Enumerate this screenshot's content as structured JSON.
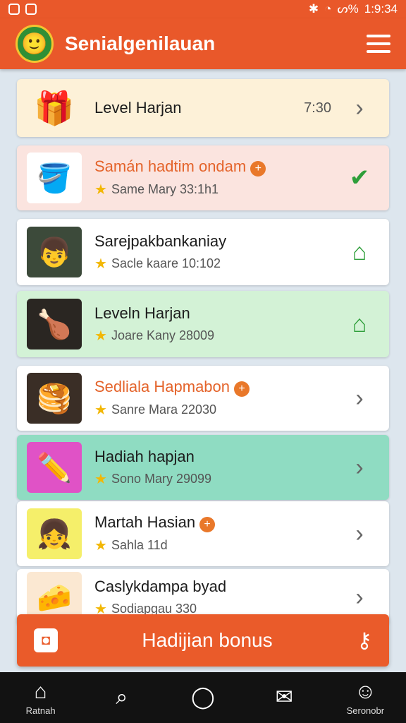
{
  "status": {
    "time": "1:9:34",
    "battery": "ᔕ%"
  },
  "header": {
    "title": "Senialgenilauan"
  },
  "rows": [
    {
      "title": "Level Harjan",
      "time": "7:30",
      "action": "chevron-right"
    },
    {
      "title": "Samán hadtim ondam",
      "sub": "Same Mary 33:1h1",
      "action": "check"
    },
    {
      "title": "Sarejpakbankaniay",
      "sub": "Sacle kaare 10:102",
      "action": "home"
    },
    {
      "title": "Leveln Harjan",
      "sub": "Joare Kany 28009",
      "action": "home"
    },
    {
      "title": "Sedliala Hapmabon",
      "sub": "Sanre Mara 22030",
      "action": "chevron-right"
    },
    {
      "title": "Hadiah hapjan",
      "sub": "Sono Mary 29099",
      "action": "chevron-right"
    },
    {
      "title": "Martah Hasian",
      "sub": "Sahla 11d",
      "action": "chevron-right"
    },
    {
      "title": "Caslykdampa byad",
      "sub": "Sodiapgau 330",
      "action": "chevron-right"
    }
  ],
  "bonus": {
    "label": "Hadijian bonus"
  },
  "nav": [
    {
      "label": "Ratnah",
      "icon": "home-icon"
    },
    {
      "label": "",
      "icon": "search-icon"
    },
    {
      "label": "",
      "icon": "circle-icon"
    },
    {
      "label": "",
      "icon": "mail-icon"
    },
    {
      "label": "Seronobr",
      "icon": "profile-icon"
    }
  ],
  "colors": {
    "primary": "#e9582a",
    "green": "#2e9e3a",
    "nav": "#121212"
  }
}
